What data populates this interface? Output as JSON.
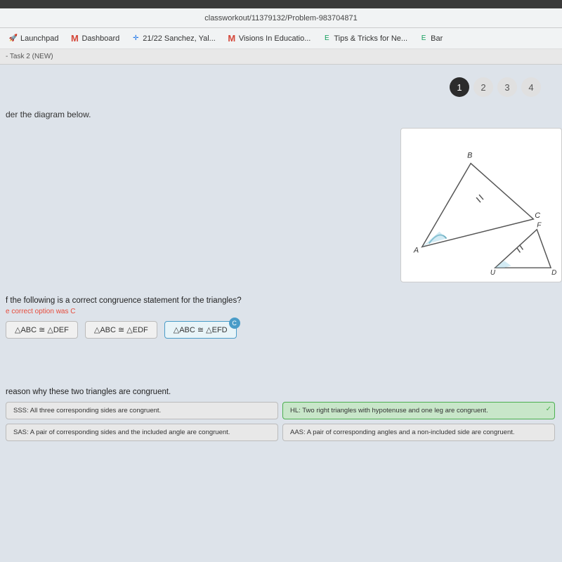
{
  "browser": {
    "url": "classworkout/11379132/Problem-983704871",
    "bookmarks": [
      {
        "label": "Launchpad",
        "icon": "🚀",
        "type": "launchpad"
      },
      {
        "label": "Dashboard",
        "icon": "M",
        "type": "m"
      },
      {
        "label": "21/22 Sanchez, Yal...",
        "icon": "+",
        "type": "blue"
      },
      {
        "label": "Visions In Educatio...",
        "icon": "M",
        "type": "m"
      },
      {
        "label": "Tips & Tricks for Ne...",
        "icon": "E",
        "type": "green"
      },
      {
        "label": "Bar",
        "icon": "E",
        "type": "green"
      }
    ]
  },
  "tab": {
    "label": "- Task 2 (NEW)"
  },
  "pagination": {
    "pages": [
      "1",
      "2",
      "3",
      "4"
    ],
    "active": "1"
  },
  "instruction": "der the diagram below.",
  "question": {
    "text": "f the following is a correct congruence statement for the triangles?",
    "correct_notice": "e correct option was C",
    "options": [
      {
        "label": "△ABC ≅ △DEF",
        "selected": false,
        "id": "opt-a"
      },
      {
        "label": "△ABC ≅ △EDF",
        "selected": false,
        "id": "opt-b"
      },
      {
        "label": "△ABC ≅ △EFD",
        "selected": true,
        "badge": "C",
        "id": "opt-c"
      }
    ]
  },
  "reason": {
    "text": "reason why these two triangles are congruent.",
    "options": [
      {
        "label": "SSS: All three corresponding sides are congruent.",
        "selected": false,
        "id": "reason-sss"
      },
      {
        "label": "HL: Two right triangles with hypotenuse and one leg are congruent.",
        "selected": true,
        "id": "reason-hl"
      },
      {
        "label": "SAS: A pair of corresponding sides and the included angle are congruent.",
        "selected": false,
        "id": "reason-sas"
      },
      {
        "label": "AAS: A pair of corresponding angles and a non-included side are congruent.",
        "selected": false,
        "id": "reason-aas"
      }
    ]
  }
}
